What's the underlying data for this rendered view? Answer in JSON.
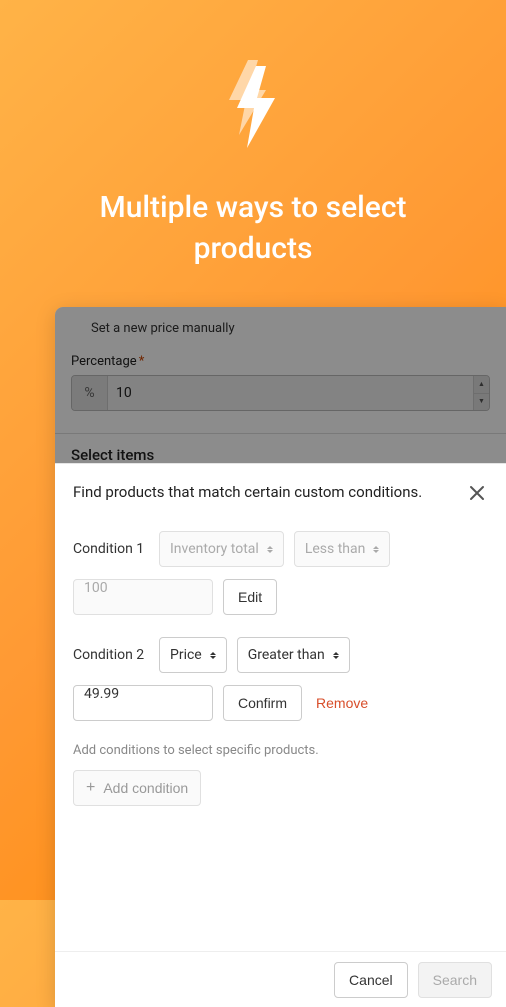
{
  "hero": {
    "title": "Multiple ways to select products"
  },
  "dimmed": {
    "radio_label": "Set a new price manually",
    "percentage_label": "Percentage",
    "percentage_prefix": "%",
    "percentage_value": "10",
    "select_items_label": "Select items"
  },
  "modal": {
    "title": "Find products that match certain custom conditions.",
    "conditions": [
      {
        "label": "Condition 1",
        "field": "Inventory total",
        "operator": "Less than",
        "value": "100",
        "action": "Edit"
      },
      {
        "label": "Condition 2",
        "field": "Price",
        "operator": "Greater than",
        "value": "49.99",
        "action": "Confirm"
      }
    ],
    "remove_label": "Remove",
    "helper_text": "Add conditions to select specific products.",
    "add_condition_label": "Add condition",
    "cancel_label": "Cancel",
    "search_label": "Search"
  }
}
